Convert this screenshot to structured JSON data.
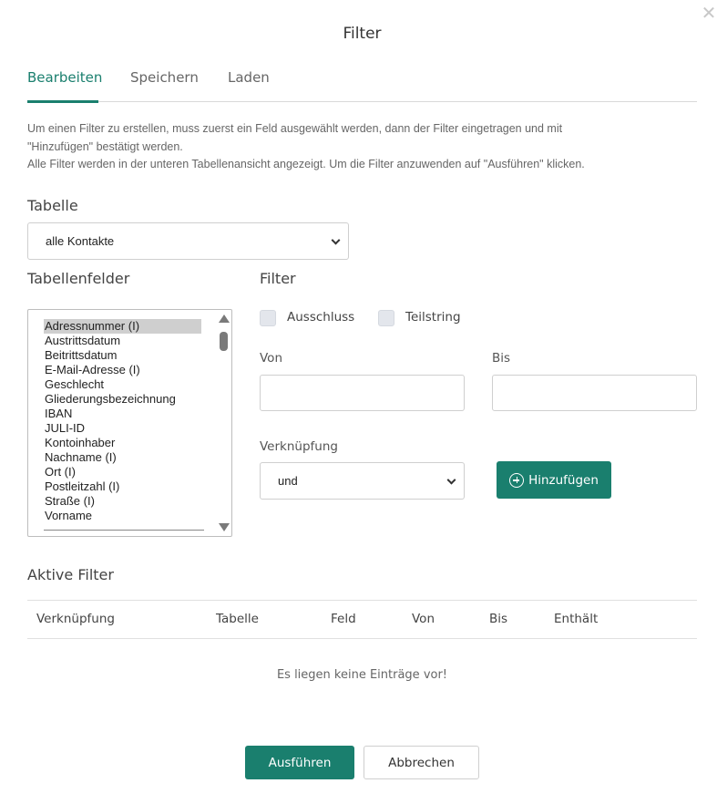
{
  "dialog": {
    "title": "Filter",
    "close_glyph": "✕"
  },
  "tabs": [
    {
      "label": "Bearbeiten",
      "active": true
    },
    {
      "label": "Speichern",
      "active": false
    },
    {
      "label": "Laden",
      "active": false
    }
  ],
  "description": {
    "line1": "Um einen Filter zu erstellen, muss zuerst ein Feld ausgewählt werden, dann der Filter eingetragen und mit",
    "line2": "\"Hinzufügen\" bestätigt werden.",
    "line3": "Alle Filter werden in der unteren Tabellenansicht angezeigt. Um die Filter anzuwenden auf \"Ausführen\" klicken."
  },
  "table_section": {
    "label": "Tabelle",
    "selected": "alle Kontakte"
  },
  "fields_section": {
    "label": "Tabellenfelder",
    "items": [
      "Adressnummer (I)",
      "Austrittsdatum",
      "Beitrittsdatum",
      "E-Mail-Adresse (I)",
      "Geschlecht",
      "Gliederungsbezeichnung",
      "IBAN",
      "JULI-ID",
      "Kontoinhaber",
      "Nachname (I)",
      "Ort (I)",
      "Postleitzahl (I)",
      "Straße (I)",
      "Vorname"
    ],
    "selected_index": 0
  },
  "filter_section": {
    "label": "Filter",
    "ausschluss_label": "Ausschluss",
    "teilstring_label": "Teilstring",
    "von_label": "Von",
    "bis_label": "Bis",
    "von_value": "",
    "bis_value": "",
    "verknuepfung_label": "Verknüpfung",
    "verknuepfung_selected": "und",
    "add_button": "Hinzufügen"
  },
  "active_filters": {
    "label": "Aktive Filter",
    "columns": [
      "Verknüpfung",
      "Tabelle",
      "Feld",
      "Von",
      "Bis",
      "Enthält"
    ],
    "empty_text": "Es liegen keine Einträge vor!"
  },
  "footer": {
    "run_button": "Ausführen",
    "cancel_button": "Abbrechen"
  },
  "colors": {
    "accent": "#1a7f6e",
    "checkbox_bg": "#e3e6ec"
  },
  "icons": {
    "close": "close-icon",
    "add": "plus-circle-icon",
    "select_arrow": "chevron-down-icon"
  }
}
